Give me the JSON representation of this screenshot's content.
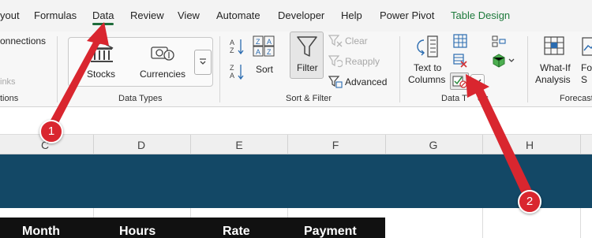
{
  "tabs": [
    {
      "label": "yout"
    },
    {
      "label": "Formulas"
    },
    {
      "label": "Data"
    },
    {
      "label": "Review"
    },
    {
      "label": "View"
    },
    {
      "label": "Automate"
    },
    {
      "label": "Developer"
    },
    {
      "label": "Help"
    },
    {
      "label": "Power Pivot"
    },
    {
      "label": "Table Design"
    }
  ],
  "active_tab": "Data",
  "ribbon": {
    "connections_group": {
      "connections_label": "onnections",
      "links_label": "inks",
      "group_label": "tions"
    },
    "data_types": {
      "stocks": "Stocks",
      "currencies": "Currencies",
      "group_label": "Data Types"
    },
    "sort_filter": {
      "sort": "Sort",
      "filter": "Filter",
      "clear": "Clear",
      "reapply": "Reapply",
      "advanced": "Advanced",
      "group_label": "Sort & Filter"
    },
    "data_tools": {
      "text_to_columns_line1": "Text to",
      "text_to_columns_line2": "Columns",
      "group_label_part1": "Data T",
      "group_label_part2": "ols"
    },
    "forecast": {
      "what_if_line1": "What-If",
      "what_if_line2": "Analysis",
      "forecast_sheet_line1": "Fo",
      "forecast_sheet_line2": "S",
      "group_label": "Forecast"
    }
  },
  "sheet": {
    "columns": [
      "C",
      "D",
      "E",
      "F",
      "G",
      "H"
    ],
    "table_headers": [
      "Month",
      "Hours",
      "Rate",
      "Payment"
    ],
    "banner_color": "#134866"
  },
  "annotations": [
    {
      "number": "1"
    },
    {
      "number": "2"
    }
  ],
  "colors": {
    "accent_green": "#1e6b3a",
    "callout_red": "#d9262f"
  }
}
